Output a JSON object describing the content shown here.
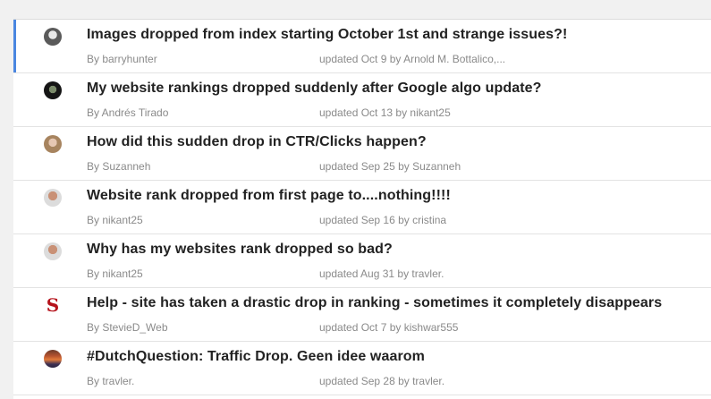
{
  "threads": [
    {
      "title": "Images dropped from index starting October 1st and strange issues?!",
      "by": "By barryhunter",
      "updated": "updated Oct 9 by Arnold M. Bottalico,...",
      "avatar": "user-avatar-icon",
      "active": true
    },
    {
      "title": "My website rankings dropped suddenly after Google algo update?",
      "by": "By Andrés Tirado",
      "updated": "updated Oct 13 by nikant25",
      "avatar": "user-avatar-icon"
    },
    {
      "title": "How did this sudden drop in CTR/Clicks happen?",
      "by": "By Suzanneh",
      "updated": "updated Sep 25 by Suzanneh",
      "avatar": "user-avatar-icon"
    },
    {
      "title": "Website rank dropped from first page to....nothing!!!!",
      "by": "By nikant25",
      "updated": "updated Sep 16 by cristina",
      "avatar": "user-avatar-icon"
    },
    {
      "title": "Why has my websites rank dropped so bad?",
      "by": "By nikant25",
      "updated": "updated Aug 31 by travler.",
      "avatar": "user-avatar-icon"
    },
    {
      "title": "Help - site has taken a drastic drop in ranking - sometimes it completely disappears",
      "by": "By StevieD_Web",
      "updated": "updated Oct 7 by kishwar555",
      "avatar_letter": "S",
      "avatar": "letter-avatar-icon",
      "letter_color": "#b5121b"
    },
    {
      "title": "#DutchQuestion: Traffic Drop. Geen idee waarom",
      "by": "By travler.",
      "updated": "updated Sep 28 by travler.",
      "avatar": "user-avatar-icon"
    }
  ],
  "colors": {
    "accent": "#4a86e0",
    "title_text": "#222222",
    "meta_text": "#8a8a8a",
    "background": "#f1f1f1"
  }
}
